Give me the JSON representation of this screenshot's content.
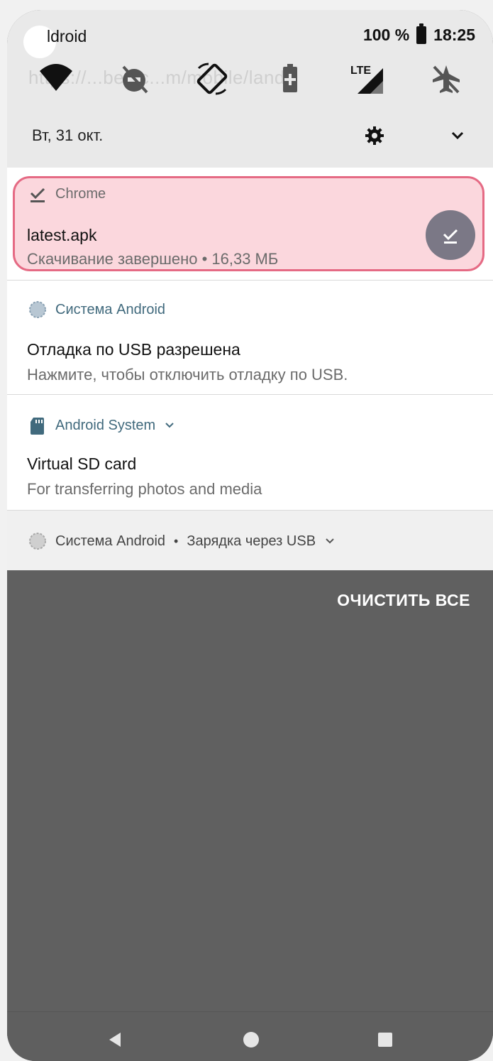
{
  "status": {
    "left_text": "ldroid",
    "battery": "100 %",
    "time": "18:25"
  },
  "qs": {
    "url_ghost": "https://...berlic...m/mobile/landi",
    "date": "Вт, 31 окт."
  },
  "notifications": [
    {
      "app": "Chrome",
      "title": "latest.apk",
      "subtitle": "Скачивание завершено • 16,33 МБ"
    },
    {
      "app": "Система Android",
      "title": "Отладка по USB разрешена",
      "subtitle": "Нажмите, чтобы отключить отладку по USB."
    },
    {
      "app": "Android System",
      "title": "Virtual SD card",
      "subtitle": "For transferring photos and media"
    },
    {
      "app": "Система Android",
      "extra": "Зарядка через USB"
    }
  ],
  "actions": {
    "clear_all": "ОЧИСТИТЬ ВСЕ"
  },
  "colors": {
    "highlight": "#fbd7dd",
    "highlight_border": "#e56a84",
    "shade_bg": "#606060",
    "accent_text": "#416a7d"
  }
}
